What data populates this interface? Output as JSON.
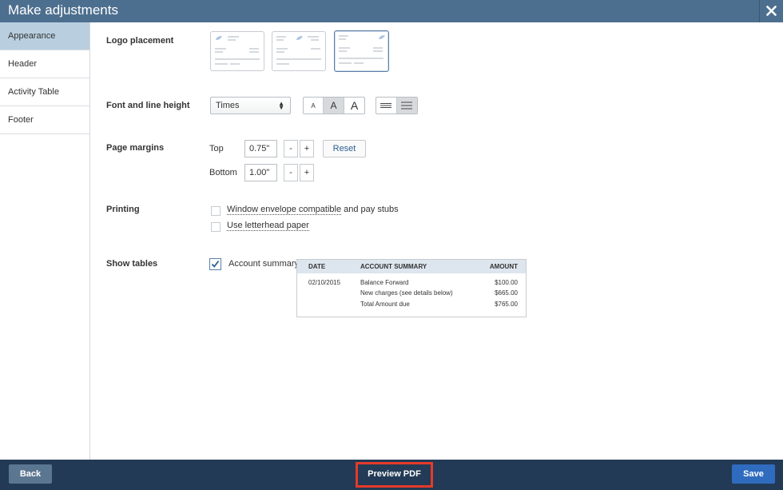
{
  "titlebar": {
    "title": "Make adjustments"
  },
  "sidebar": {
    "items": [
      {
        "label": "Appearance"
      },
      {
        "label": "Header"
      },
      {
        "label": "Activity Table"
      },
      {
        "label": "Footer"
      }
    ]
  },
  "sections": {
    "logo_placement": "Logo placement",
    "font_line_height": "Font and line height",
    "page_margins": "Page margins",
    "printing": "Printing",
    "show_tables": "Show tables"
  },
  "font": {
    "selected": "Times",
    "size_small": "A",
    "size_medium": "A",
    "size_large": "A"
  },
  "margins": {
    "top_label": "Top",
    "top_value": "0.75\"",
    "bottom_label": "Bottom",
    "bottom_value": "1.00\"",
    "minus": "-",
    "plus": "+",
    "reset_label": "Reset"
  },
  "printing": {
    "window_envelope": "Window envelope compatible",
    "window_envelope_suffix": " and pay stubs",
    "letterhead": "Use letterhead paper"
  },
  "tables": {
    "account_summary_label": "Account summary",
    "sample": {
      "headers": [
        "DATE",
        "ACCOUNT SUMMARY",
        "AMOUNT"
      ],
      "rows": [
        [
          "02/10/2015",
          "Balance Forward",
          "$100.00"
        ],
        [
          "",
          "New charges (see details below)",
          "$665.00"
        ],
        [
          "",
          "Total Amount due",
          "$765.00"
        ]
      ]
    }
  },
  "footer": {
    "back_label": "Back",
    "preview_label": "Preview PDF",
    "save_label": "Save"
  },
  "colors": {
    "titlebar": "#4d6f8f",
    "footer": "#223a55",
    "save": "#2f6cbf",
    "highlight": "#e53a2a",
    "sidebar_active": "#b9cfe0"
  }
}
